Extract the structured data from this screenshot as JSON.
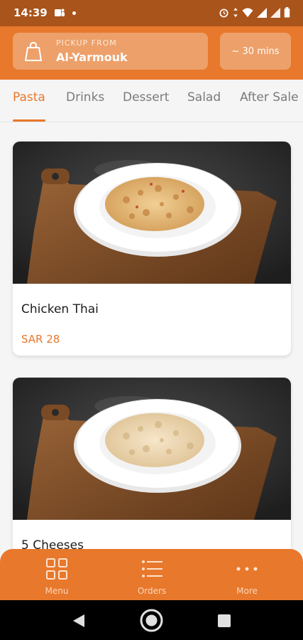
{
  "status_bar": {
    "time": "14:39"
  },
  "header": {
    "pickup_label": "PICKUP FROM",
    "pickup_location": "Al-Yarmouk",
    "eta": "~ 30 mins"
  },
  "tabs": [
    {
      "label": "Pasta",
      "active": true
    },
    {
      "label": "Drinks",
      "active": false
    },
    {
      "label": "Dessert",
      "active": false
    },
    {
      "label": "Salad",
      "active": false
    },
    {
      "label": "After Sale M",
      "active": false
    }
  ],
  "menu_items": [
    {
      "title": "Chicken Thai",
      "price": "SAR 28"
    },
    {
      "title": "5 Cheeses"
    }
  ],
  "bottom_nav": [
    {
      "label": "Menu",
      "icon": "grid-icon"
    },
    {
      "label": "Orders",
      "icon": "list-icon"
    },
    {
      "label": "More",
      "icon": "more-dots-icon"
    }
  ],
  "colors": {
    "accent": "#e8782b",
    "status_bar": "#a9541b",
    "pill": "#eda06a"
  }
}
